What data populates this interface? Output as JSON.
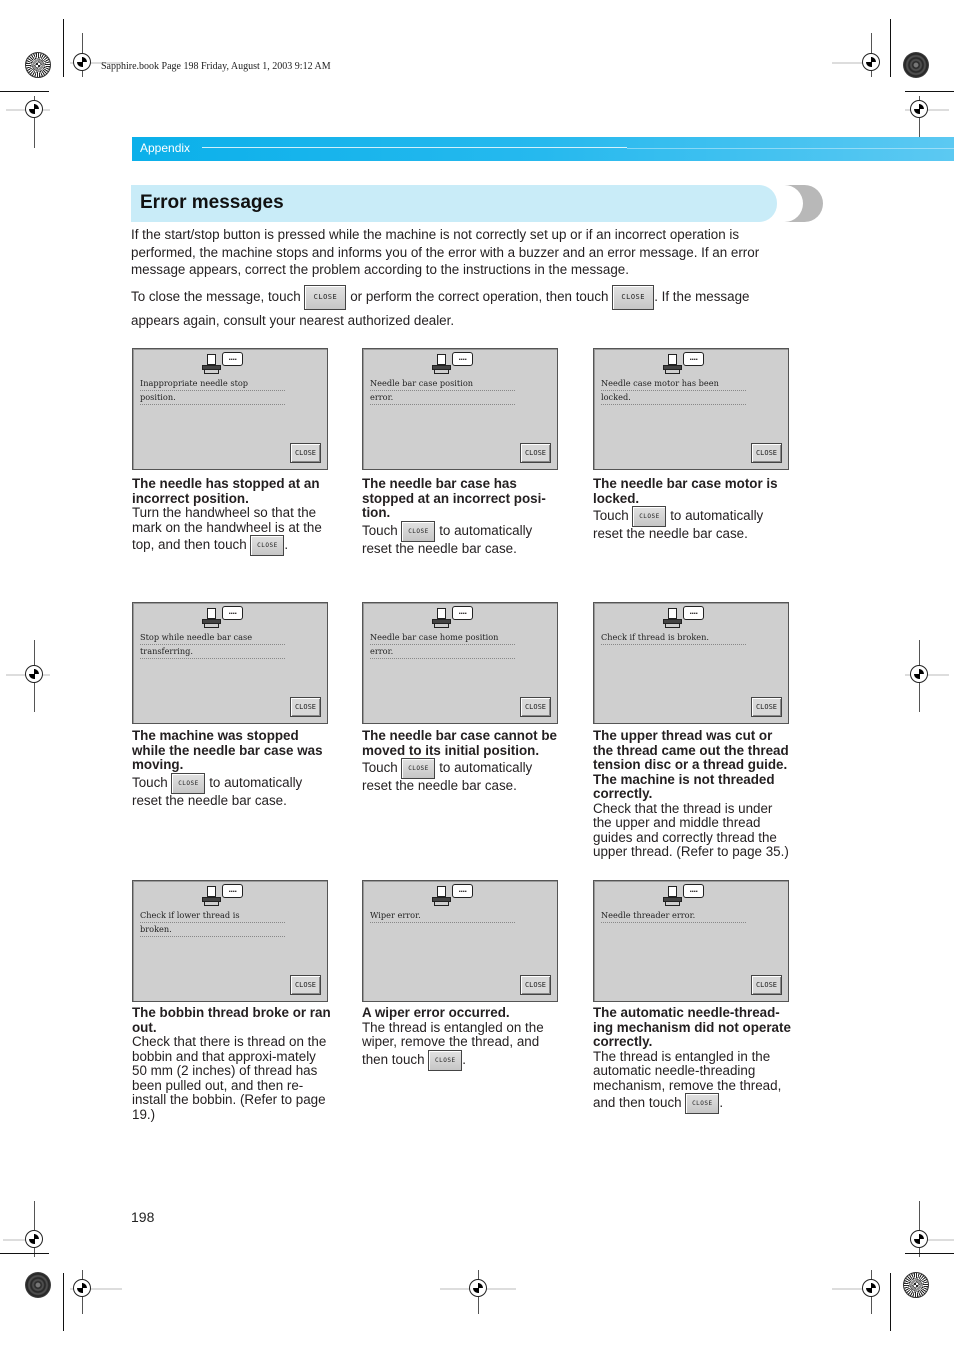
{
  "slug": "Sapphire.book  Page 198  Friday, August 1, 2003  9:12 AM",
  "header": {
    "section": "Appendix"
  },
  "title": "Error messages",
  "intro": {
    "paragraph1": "If the start/stop button is pressed while the machine is not correctly set up or if an incorrect operation is performed, the machine stops and informs you of the error with a buzzer and an error message. If an error message appears, correct the problem according to the instructions in the message.",
    "p2_part1": "To close the message, touch",
    "p2_part2": "or perform the correct operation, then touch",
    "p2_part3": ". If the message appears again, consult your nearest authorized dealer."
  },
  "close_label": "CLOSE",
  "errors": [
    {
      "screen_lines": [
        "Inappropriate needle stop",
        "position."
      ],
      "heading": "The needle has stopped at an incorrect position.",
      "body": "Turn the handwheel so that the mark on the handwheel is at the",
      "touch_prefix": "top, and then touch",
      "touch_suffix": "."
    },
    {
      "screen_lines": [
        "Needle bar case position",
        "error."
      ],
      "heading": "The needle bar case has stopped at an incorrect posi-tion.",
      "touch_prefix": "Touch",
      "touch_suffix": "to automatically",
      "after": "reset the needle bar case."
    },
    {
      "screen_lines": [
        "Needle case motor has been",
        "locked."
      ],
      "heading": "The needle bar case motor is locked.",
      "touch_prefix": "Touch",
      "touch_suffix": "to automatically",
      "after": "reset the needle bar case."
    },
    {
      "screen_lines": [
        "Stop while needle bar case",
        "transferring."
      ],
      "heading": "The machine was stopped while the needle bar case was moving.",
      "touch_prefix": "Touch",
      "touch_suffix": "to automatically",
      "after": "reset the needle bar case."
    },
    {
      "screen_lines": [
        "Needle bar case home position",
        "error."
      ],
      "heading": "The needle bar case cannot be moved to its initial position.",
      "touch_prefix": "Touch",
      "touch_suffix": "to automatically",
      "after": "reset the needle bar case."
    },
    {
      "screen_lines": [
        "Check if thread is broken."
      ],
      "heading": "The upper thread was cut or the thread came out the thread tension disc or a thread guide. The machine is not threaded correctly.",
      "body": "Check that the thread is under the upper and middle thread guides and correctly thread the upper thread. (Refer to page 35.)"
    },
    {
      "screen_lines": [
        "Check if lower thread is",
        "broken."
      ],
      "heading": "The bobbin thread broke or ran out.",
      "body": "Check that there is thread on the bobbin and that approxi-mately 50 mm (2 inches) of thread has been pulled out, and then re-install the bobbin. (Refer to page 19.)"
    },
    {
      "screen_lines": [
        "Wiper error."
      ],
      "heading": "A wiper error occurred.",
      "body": "The thread is entangled on the wiper, remove the thread, and",
      "touch_prefix": "then touch",
      "touch_suffix": "."
    },
    {
      "screen_lines": [
        "Needle threader error."
      ],
      "heading": "The automatic needle-thread-ing mechanism did not operate correctly.",
      "body": "The thread is entangled in the automatic needle-threading mechanism, remove the thread,",
      "touch_prefix": "and then touch",
      "touch_suffix": "."
    }
  ],
  "page_number": "198"
}
